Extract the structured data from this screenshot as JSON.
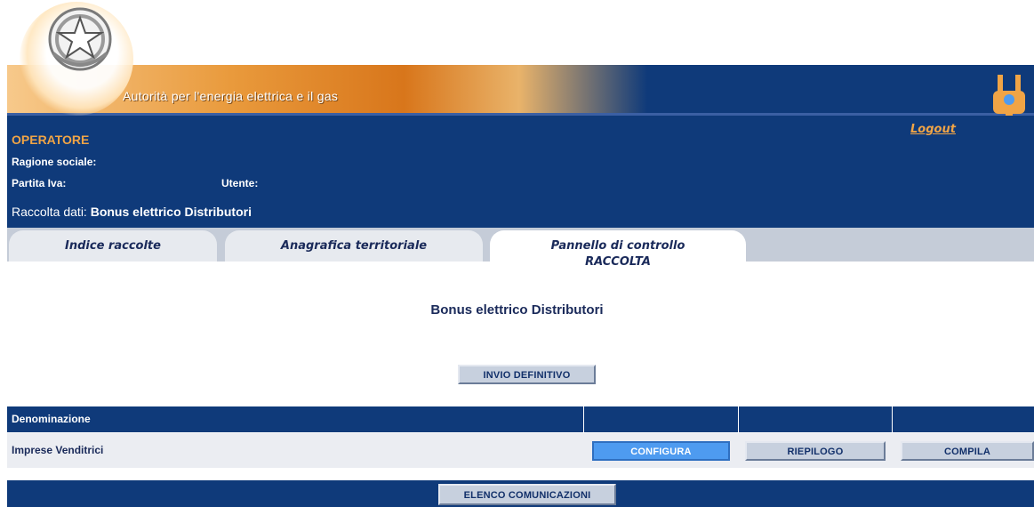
{
  "banner": {
    "title": "Autorità per l'energia elettrica e il gas",
    "logo_icon": "republic-emblem-icon",
    "plug_icon": "energy-plug-icon"
  },
  "operator": {
    "title": "OPERATORE",
    "ragione_sociale_label": "Ragione sociale:",
    "partita_iva_label": "Partita Iva:",
    "utente_label": "Utente:",
    "raccolta_prefix": "Raccolta dati: ",
    "raccolta_name": "Bonus elettrico Distributori",
    "logout_label": "Logout"
  },
  "tabs": [
    {
      "label": "Indice raccolte"
    },
    {
      "label": "Anagrafica territoriale"
    },
    {
      "label": "Pannello di controllo",
      "sublabel": "RACCOLTA"
    }
  ],
  "main": {
    "title": "Bonus elettrico Distributori",
    "invio_button": "INVIO DEFINITIVO"
  },
  "table": {
    "headers": [
      "Denominazione",
      "",
      "",
      ""
    ],
    "rows": [
      {
        "name": "Imprese Venditrici",
        "actions": [
          "CONFIGURA",
          "RIEPILOGO",
          "COMPILA"
        ]
      }
    ]
  },
  "footer": {
    "elenco_button": "ELENCO COMUNICAZIONI"
  },
  "colors": {
    "navy": "#0f3a7a",
    "orange": "#f0a446",
    "active_button": "#4e9bf0"
  }
}
